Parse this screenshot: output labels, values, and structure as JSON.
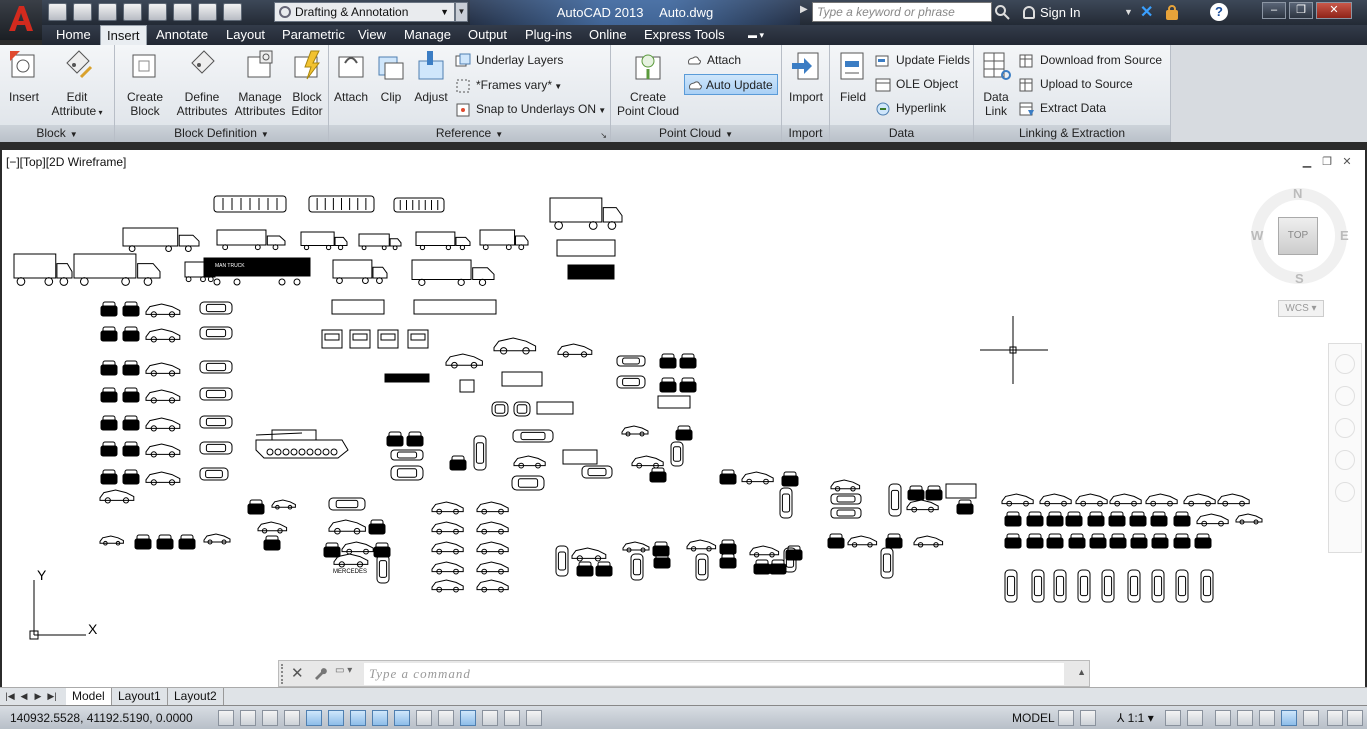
{
  "window": {
    "app_name": "AutoCAD 2013",
    "file_name": "Auto.dwg",
    "workspace": "Drafting & Annotation",
    "search_placeholder": "Type a keyword or phrase",
    "sign_in": "Sign In",
    "minimize": "–",
    "restore": "❐",
    "close": "✕"
  },
  "ribbon": {
    "tabs": [
      "Home",
      "Insert",
      "Annotate",
      "Layout",
      "Parametric",
      "View",
      "Manage",
      "Output",
      "Plug-ins",
      "Online",
      "Express Tools"
    ],
    "active_tab": "Insert",
    "panels": {
      "block": {
        "title": "Block",
        "insert": "Insert",
        "edit_attribute_1": "Edit",
        "edit_attribute_2": "Attribute"
      },
      "block_definition": {
        "title": "Block Definition",
        "create_block_1": "Create",
        "create_block_2": "Block",
        "define_attr_1": "Define",
        "define_attr_2": "Attributes",
        "manage_attr_1": "Manage",
        "manage_attr_2": "Attributes",
        "block_editor_1": "Block",
        "block_editor_2": "Editor"
      },
      "reference": {
        "title": "Reference",
        "attach": "Attach",
        "clip": "Clip",
        "adjust": "Adjust",
        "underlay_layers": "Underlay Layers",
        "frames_vary": "*Frames vary*",
        "snap_underlays": "Snap to Underlays ON"
      },
      "point_cloud": {
        "title": "Point Cloud",
        "create_1": "Create",
        "create_2": "Point Cloud",
        "attach": "Attach",
        "auto_update": "Auto Update"
      },
      "import": {
        "title": "Import",
        "import": "Import"
      },
      "data": {
        "title": "Data",
        "field": "Field",
        "update_fields": "Update Fields",
        "ole_object": "OLE Object",
        "hyperlink": "Hyperlink"
      },
      "linking": {
        "title": "Linking & Extraction",
        "data_link_1": "Data",
        "data_link_2": "Link",
        "download_source": "Download from Source",
        "upload_source": "Upload to Source",
        "extract_data": "Extract  Data"
      }
    }
  },
  "viewport": {
    "label": "[−][Top][2D Wireframe]",
    "viewcube_face": "TOP",
    "compass": {
      "n": "N",
      "s": "S",
      "e": "E",
      "w": "W"
    },
    "wcs": "WCS ▾",
    "ucs_x": "X",
    "ucs_y": "Y",
    "drawing_text": {
      "truck_label": "MAN TRUCK",
      "mercedes": "MERCEDES"
    }
  },
  "command_line": {
    "placeholder": "Type  a  command"
  },
  "layout_tabs": [
    "Model",
    "Layout1",
    "Layout2"
  ],
  "status_bar": {
    "coordinates": "140932.5528, 41192.5190, 0.0000",
    "model": "MODEL",
    "annotation_scale": "1:1"
  }
}
